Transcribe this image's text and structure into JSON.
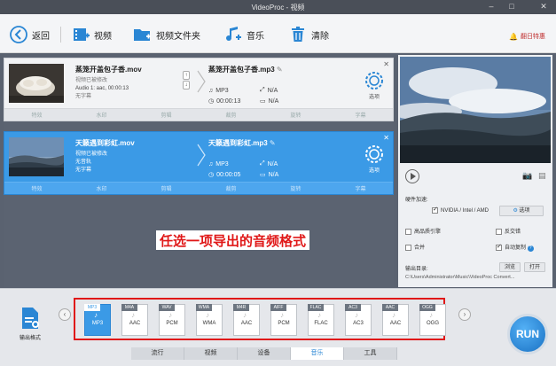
{
  "window": {
    "title": "VideoProc - 视频"
  },
  "toolbar": {
    "back": "返回",
    "video": "视频",
    "video_folder": "视频文件夹",
    "music": "音乐",
    "clear": "清除",
    "right_link": "翻日特惠"
  },
  "tasks": [
    {
      "source_name": "蒸笼开盖包子香.mov",
      "meta1": "视频已被修改",
      "meta2": "Audio 1: aac, 00:00:13",
      "meta3": "无字幕",
      "output_name": "蒸笼开盖包子香.mp3",
      "out_format": "MP3",
      "out_res": "N/A",
      "out_dur": "00:00:13",
      "out_size": "N/A",
      "options": "选项",
      "edits": [
        "特效",
        "水印",
        "剪辑",
        "裁剪",
        "旋转",
        "字幕"
      ],
      "selected": false
    },
    {
      "source_name": "天籁遇到彩虹.mov",
      "meta1": "视频已被修改",
      "meta2": "无音轨",
      "meta3": "无字幕",
      "output_name": "天籁遇到彩虹.mp3",
      "out_format": "MP3",
      "out_res": "N/A",
      "out_dur": "00:00:05",
      "out_size": "N/A",
      "options": "选项",
      "edits": [
        "特效",
        "水印",
        "剪辑",
        "裁剪",
        "旋转",
        "字幕"
      ],
      "selected": true
    }
  ],
  "overlay_caption": "任选一项导出的音频格式",
  "right_panel": {
    "hw_label": "硬件加速:",
    "hw_value": "NVIDIA / Intel / AMD",
    "options": "选项",
    "hq": "高品质引擎",
    "deinterlace": "反交错",
    "merge": "合并",
    "auto_copy": "自动复制",
    "auto_copy_help": "?",
    "output_dir_label": "输出目录:",
    "browse": "浏览",
    "open": "打开",
    "output_path": "C:\\Users\\Administrator\\Music\\VideoProc Convert..."
  },
  "bottom": {
    "tool_label": "输出格式",
    "formats": [
      {
        "tag": "MP3",
        "label": "MP3",
        "active": true
      },
      {
        "tag": "M4A",
        "label": "AAC",
        "active": false
      },
      {
        "tag": "WAV",
        "label": "PCM",
        "active": false
      },
      {
        "tag": "WMA",
        "label": "WMA",
        "active": false
      },
      {
        "tag": "M4R",
        "label": "AAC",
        "active": false
      },
      {
        "tag": "AIFF",
        "label": "PCM",
        "active": false
      },
      {
        "tag": "FLAC",
        "label": "FLAC",
        "active": false
      },
      {
        "tag": "AC3",
        "label": "AC3",
        "active": false
      },
      {
        "tag": "AAC",
        "label": "AAC",
        "active": false
      },
      {
        "tag": "OGG",
        "label": "OGG",
        "active": false
      }
    ],
    "tabs": [
      {
        "label": "流行",
        "active": false
      },
      {
        "label": "视频",
        "active": false
      },
      {
        "label": "设备",
        "active": false
      },
      {
        "label": "音乐",
        "active": true
      },
      {
        "label": "工具",
        "active": false
      }
    ],
    "run": "RUN"
  },
  "colors": {
    "accent": "#3b9ae6",
    "highlight": "#e01818",
    "run": "#1a72c4"
  }
}
